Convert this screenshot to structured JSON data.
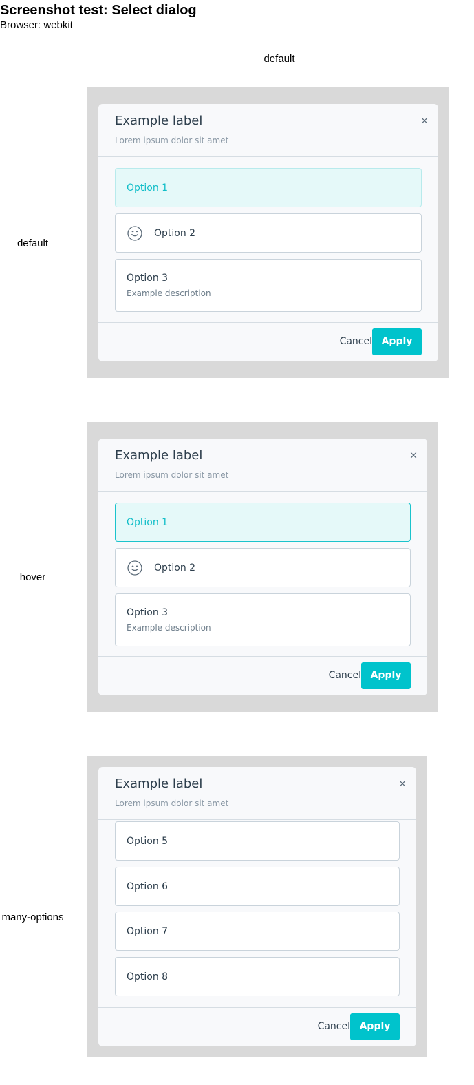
{
  "page": {
    "title": "Screenshot test: Select dialog",
    "browser": "Browser: webkit",
    "column_header": "default"
  },
  "colors": {
    "stage_background": "#d9d9d9",
    "dialog_background": "#f8f9fb",
    "accent": "#00c3cc",
    "selected_background": "#e5f9f9",
    "text_primary": "#2d3e4c",
    "text_muted": "#8a98a5"
  },
  "dialog": {
    "title": "Example label",
    "subtitle": "Lorem ipsum dolor sit amet",
    "close_icon": "×",
    "cancel_label": "Cancel",
    "apply_label": "Apply"
  },
  "variants": [
    {
      "row_label": "default",
      "options": [
        {
          "label": "Option 1",
          "selected": true
        },
        {
          "label": "Option 2",
          "icon": "smiley-icon"
        },
        {
          "label": "Option 3",
          "description": "Example description"
        }
      ]
    },
    {
      "row_label": "hover",
      "options": [
        {
          "label": "Option 1",
          "selected": true,
          "hovered": true
        },
        {
          "label": "Option 2",
          "icon": "smiley-icon"
        },
        {
          "label": "Option 3",
          "description": "Example description"
        }
      ]
    },
    {
      "row_label": "many-options",
      "options": [
        {
          "label": "Option 5"
        },
        {
          "label": "Option 6"
        },
        {
          "label": "Option 7"
        },
        {
          "label": "Option 8"
        }
      ]
    }
  ]
}
